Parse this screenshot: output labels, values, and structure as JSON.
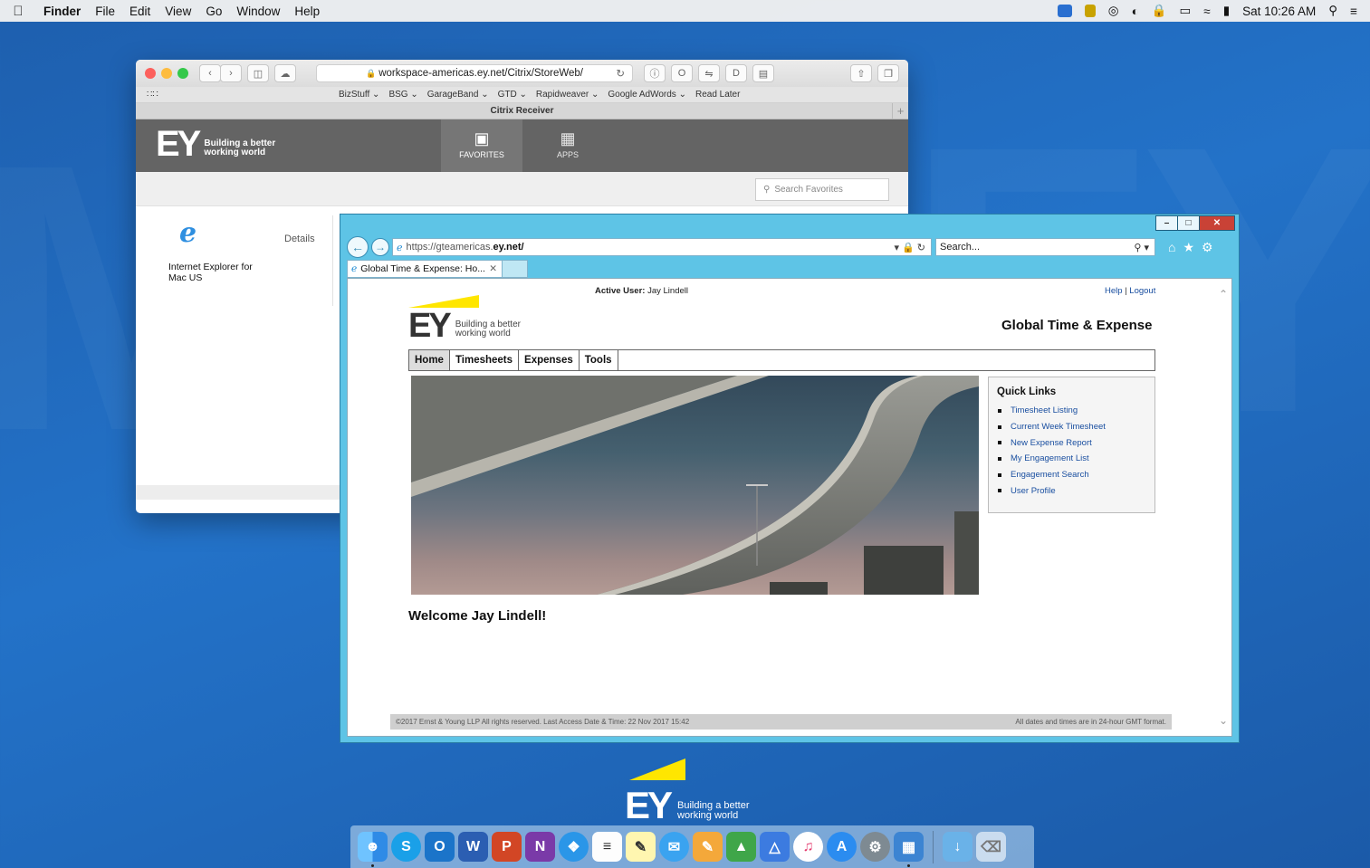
{
  "menubar": {
    "app": "Finder",
    "items": [
      "File",
      "Edit",
      "View",
      "Go",
      "Window",
      "Help"
    ],
    "clock": "Sat 10:26 AM"
  },
  "safari": {
    "url": "workspace-americas.ey.net/Citrix/StoreWeb/",
    "bookmarks": [
      "BizStuff ⌄",
      "BSG ⌄",
      "GarageBand ⌄",
      "GTD ⌄",
      "Rapidweaver ⌄",
      "Google AdWords ⌄",
      "Read Later"
    ],
    "tab_title": "Citrix Receiver",
    "header": {
      "logo": "EY",
      "tagline": "Building a better working world",
      "tabs": [
        {
          "label": "FAVORITES",
          "icon": "bookmark-icon"
        },
        {
          "label": "APPS",
          "icon": "apps-grid-icon"
        }
      ]
    },
    "search_placeholder": "Search Favorites",
    "app_tile": {
      "name": "Internet Explorer for Mac US",
      "details": "Details"
    }
  },
  "ie": {
    "url_scheme": "https://",
    "url_sub": "gteamericas.",
    "url_domain": "ey.net/",
    "search_placeholder": "Search...",
    "tab_title": "Global Time & Expense: Ho...",
    "page": {
      "active_user_label": "Active User:",
      "active_user": "Jay Lindell",
      "help": "Help",
      "logout": "Logout",
      "logo": "EY",
      "tagline": "Building a better working world",
      "title": "Global Time & Expense",
      "nav": [
        "Home",
        "Timesheets",
        "Expenses",
        "Tools"
      ],
      "quick_links_title": "Quick Links",
      "quick_links": [
        "Timesheet Listing",
        "Current Week Timesheet",
        "New Expense Report",
        "My Engagement List",
        "Engagement Search",
        "User Profile"
      ],
      "welcome": "Welcome Jay Lindell!",
      "footer_left": "©2017 Ernst & Young LLP   All rights reserved.   Last Access Date & Time: 22 Nov 2017 15:42",
      "footer_right": "All dates and times are in 24-hour GMT format."
    }
  },
  "desktop_logo": {
    "logo": "EY",
    "tagline": "Building a better working world"
  },
  "dock": [
    "Finder",
    "Skype",
    "Outlook",
    "Word",
    "PowerPoint",
    "OneNote",
    "Safari",
    "Notes",
    "TextEdit",
    "Messages",
    "Pages",
    "Numbers",
    "Keynote",
    "iTunes",
    "App Store",
    "System Preferences",
    "Citrix Viewer",
    "Downloads",
    "Trash"
  ]
}
